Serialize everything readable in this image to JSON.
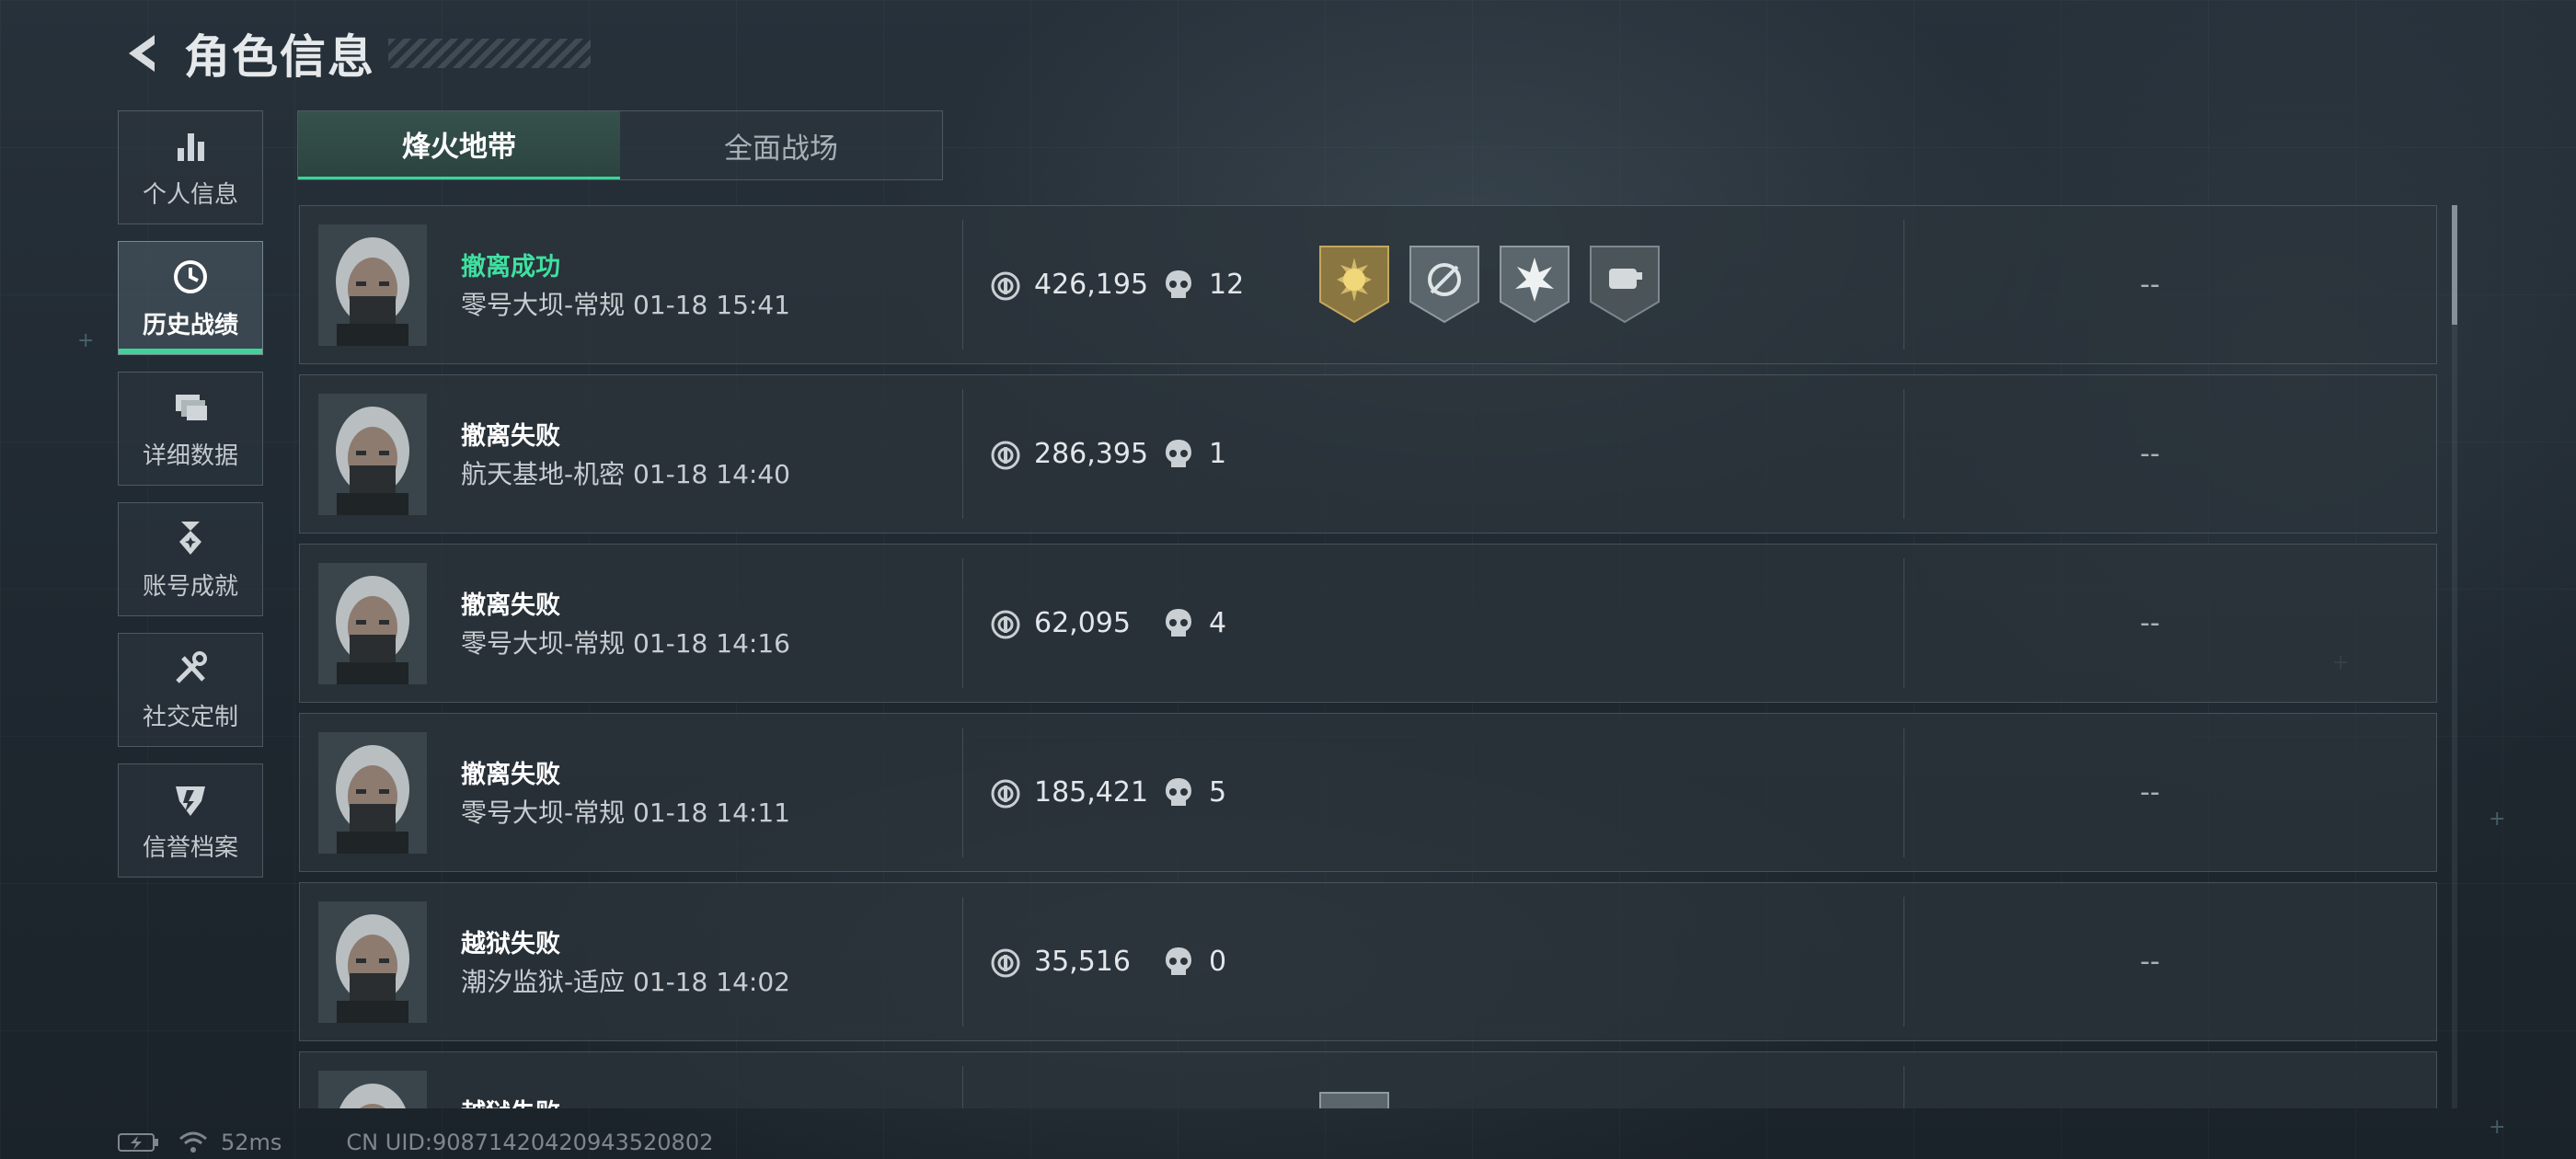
{
  "header": {
    "title": "角色信息"
  },
  "sidebar": {
    "items": [
      {
        "label": "个人信息",
        "icon": "bar-chart-icon",
        "active": false
      },
      {
        "label": "历史战绩",
        "icon": "clock-history-icon",
        "active": true
      },
      {
        "label": "详细数据",
        "icon": "stacked-cards-icon",
        "active": false
      },
      {
        "label": "账号成就",
        "icon": "medal-icon",
        "active": false
      },
      {
        "label": "社交定制",
        "icon": "tools-icon",
        "active": false
      },
      {
        "label": "信誉档案",
        "icon": "shield-emblem-icon",
        "active": false
      }
    ]
  },
  "tabs": [
    {
      "label": "烽火地带",
      "active": true
    },
    {
      "label": "全面战场",
      "active": false
    }
  ],
  "records": [
    {
      "status": "撤离成功",
      "success": true,
      "map": "零号大坝-常规 01-18 15:41",
      "value": "426,195",
      "kills": "12",
      "badges": [
        "gold-sun-badge-icon",
        "crosshair-badge-icon",
        "burst-badge-icon",
        "fist-badge-icon"
      ],
      "extra": "--"
    },
    {
      "status": "撤离失败",
      "success": false,
      "map": "航天基地-机密 01-18 14:40",
      "value": "286,395",
      "kills": "1",
      "badges": [],
      "extra": "--"
    },
    {
      "status": "撤离失败",
      "success": false,
      "map": "零号大坝-常规 01-18 14:16",
      "value": "62,095",
      "kills": "4",
      "badges": [],
      "extra": "--"
    },
    {
      "status": "撤离失败",
      "success": false,
      "map": "零号大坝-常规 01-18 14:11",
      "value": "185,421",
      "kills": "5",
      "badges": [],
      "extra": "--"
    },
    {
      "status": "越狱失败",
      "success": false,
      "map": "潮汐监狱-适应 01-18 14:02",
      "value": "35,516",
      "kills": "0",
      "badges": [],
      "extra": "--"
    },
    {
      "status": "越狱失败",
      "success": false,
      "map": "",
      "value": "",
      "kills": "",
      "badges": [
        "partial-badge-icon"
      ],
      "extra": ""
    }
  ],
  "footer": {
    "ping": "52ms",
    "uid": "CN UID:9087142042094352080​2"
  },
  "colors": {
    "accent": "#3fd39a",
    "success_text": "#3fe0a0",
    "badge_gold": "#b8a15a",
    "badge_grey": "#6f7a80"
  }
}
